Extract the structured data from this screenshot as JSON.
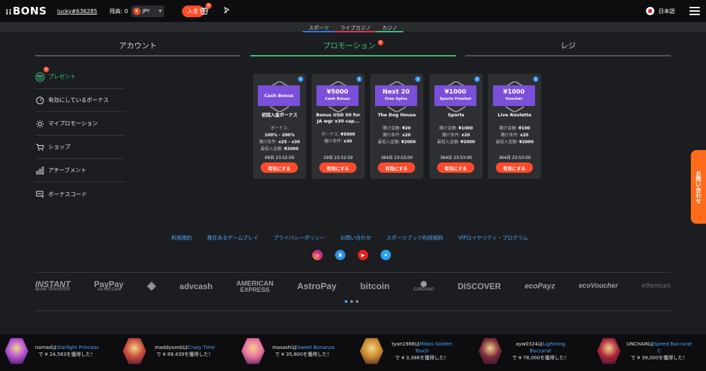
{
  "header": {
    "logo": "BONS",
    "username": "lucky#636285",
    "balance_label": "残高:",
    "balance_value": "0",
    "currency_symbol": "¥",
    "currency_code": "JPY",
    "deposit_label": "入金",
    "gift_badge": "0",
    "language": "日本語"
  },
  "categories": [
    "スポーツ",
    "ライブカジノ",
    "カジノ"
  ],
  "tabs": {
    "account": "アカウント",
    "promotion": "プロモーション",
    "promotion_badge": "5",
    "cashier": "レジ"
  },
  "sidebar": {
    "items": [
      {
        "label": "プレゼント",
        "badge": "5"
      },
      {
        "label": "有効にしているボーナス"
      },
      {
        "label": "マイプロモーション"
      },
      {
        "label": "ショップ"
      },
      {
        "label": "アチーブメント"
      },
      {
        "label": "ボーナスコード"
      }
    ]
  },
  "cards": [
    {
      "badge_line1": "Cash Bonus",
      "badge_line2": "",
      "title": "初回入金ボーナス",
      "rows": [
        {
          "label": "ボーナス:",
          "value": ""
        },
        {
          "label": "",
          "value": "100% - 200%"
        },
        {
          "label": "賭け条件:",
          "value": "x25 - x30"
        },
        {
          "label": "最低入金額:",
          "value": "¥2000"
        }
      ],
      "timer": "69日  23:52:59",
      "button": "有効にする"
    },
    {
      "badge_line1": "¥5000",
      "badge_line2": "Cash Bonus",
      "title": "Bonus USD 50 for JA wgr x30 cap...",
      "rows": [
        {
          "label": "ボーナス:",
          "value": "¥5000"
        },
        {
          "label": "賭け条件:",
          "value": "x30"
        }
      ],
      "timer": "29日  23:52:59",
      "button": "有効にする"
    },
    {
      "badge_line1": "Next 20",
      "badge_line2": "Free Spins",
      "title": "The Dog House",
      "rows": [
        {
          "label": "賭け金額:",
          "value": "¥20"
        },
        {
          "label": "賭け条件:",
          "value": "x20"
        },
        {
          "label": "最低入金額:",
          "value": "¥2000"
        }
      ],
      "timer": "364日  23:53:00",
      "button": "有効にする"
    },
    {
      "badge_line1": "¥1000",
      "badge_line2": "Sports Freebet",
      "title": "Sports",
      "rows": [
        {
          "label": "賭け金額:",
          "value": "¥1000"
        },
        {
          "label": "賭け条件:",
          "value": "x20"
        },
        {
          "label": "最低入金額:",
          "value": "¥2000"
        }
      ],
      "timer": "364日  23:53:00",
      "button": "有効にする"
    },
    {
      "badge_line1": "¥1000",
      "badge_line2": "Voucher",
      "title": "Live Roulette",
      "rows": [
        {
          "label": "賭け金額:",
          "value": "¥100"
        },
        {
          "label": "賭け条件:",
          "value": "x20"
        },
        {
          "label": "最低入金額:",
          "value": "¥2000"
        }
      ],
      "timer": "364日  23:53:00",
      "button": "有効にする"
    }
  ],
  "contact_tab": "お問い合わせ",
  "footer_links": [
    "利用規約",
    "責任あるゲームプレイ",
    "プライバシーポリシー",
    "お問い合わせ",
    "スポーツブック利用規約",
    "VIPロイヤリティ・プログラム"
  ],
  "socials": [
    "instagram",
    "bons",
    "youtube",
    "twitter"
  ],
  "payments": [
    {
      "name": "INSTANT",
      "sub": "BANK TRANSFER"
    },
    {
      "name": "PayPay",
      "sub": "Via Gift Card"
    },
    {
      "name": "◈",
      "sub": ""
    },
    {
      "name": "advcash",
      "sub": ""
    },
    {
      "name": "AMERICAN",
      "sub": "EXPRESS"
    },
    {
      "name": "AstroPay",
      "sub": ""
    },
    {
      "name": "bitcoin",
      "sub": ""
    },
    {
      "name": "✺",
      "sub": "CARDANO"
    },
    {
      "name": "DISCOVER",
      "sub": ""
    },
    {
      "name": "ecoPayz",
      "sub": ""
    },
    {
      "name": "ecoVoucher",
      "sub": ""
    },
    {
      "name": "ethereum",
      "sub": ""
    }
  ],
  "winners": [
    {
      "user": "nomad",
      "game": "Starlight Princess",
      "amount": "で ¥ 24,583を獲得した！",
      "color": "#b14fd6"
    },
    {
      "user": "maddysonb",
      "game": "Crazy Time",
      "amount": "で ¥ 89,439を獲得した！",
      "color": "#c94a3a"
    },
    {
      "user": "masashi",
      "game": "Sweet Bonanza",
      "amount": "で ¥ 35,800を獲得した！",
      "color": "#e86fa3"
    },
    {
      "user": "tyan1988",
      "game": "Midas Golden Touch",
      "amount": "で ¥ 3,386を獲得した！",
      "color": "#c9892a"
    },
    {
      "user": "ayw0324",
      "game": "Lightning Baccarat",
      "amount": "で ¥ 78,000を獲得した！",
      "color": "#7a2a3a"
    },
    {
      "user": "UNCHAIN",
      "game": "Speed Baccarat C",
      "amount": "で ¥ 39,000を獲得した！",
      "color": "#a8243a"
    }
  ],
  "win_joiner": "は"
}
